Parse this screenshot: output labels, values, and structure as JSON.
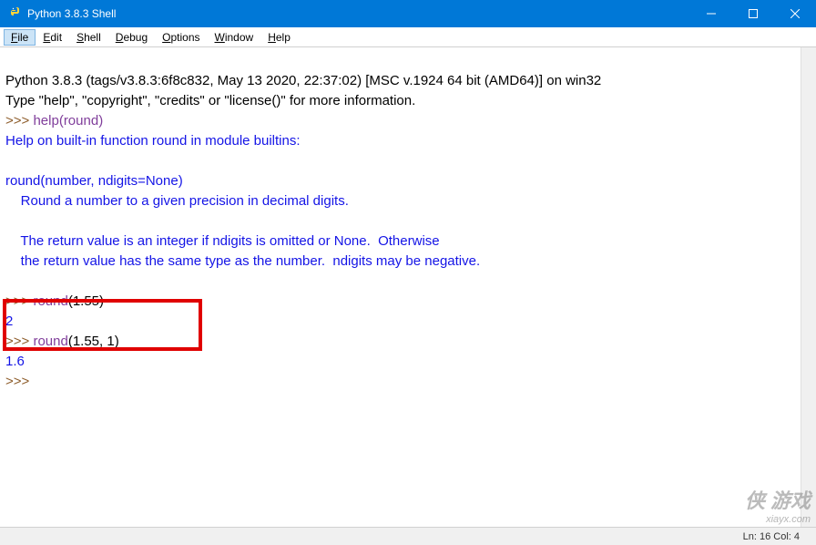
{
  "window": {
    "title": "Python 3.8.3 Shell"
  },
  "menu": {
    "file": "File",
    "edit": "Edit",
    "shell": "Shell",
    "debug": "Debug",
    "options": "Options",
    "window": "Window",
    "help": "Help"
  },
  "content": {
    "banner1": "Python 3.8.3 (tags/v3.8.3:6f8c832, May 13 2020, 22:37:02) [MSC v.1924 64 bit (AMD64)] on win32",
    "banner2": "Type \"help\", \"copyright\", \"credits\" or \"license()\" for more information.",
    "prompt": ">>> ",
    "help_call": "help",
    "lparen": "(",
    "rparen": ")",
    "round_name": "round",
    "help_out1": "Help on built-in function round in module builtins:",
    "help_out2": "round(number, ndigits=None)",
    "help_out3": "    Round a number to a given precision in decimal digits.",
    "help_out4": "    The return value is an integer if ndigits is omitted or None.  Otherwise",
    "help_out5": "    the return value has the same type as the number.  ndigits may be negative.",
    "call1_args": "1.55",
    "result1": "2",
    "call2_args": "1.55, 1",
    "result2": "1.6",
    "blank": ""
  },
  "status": {
    "pos": "Ln: 16  Col: 4"
  },
  "watermark": {
    "main": "侠 游戏",
    "sub": "xiayx.com"
  }
}
